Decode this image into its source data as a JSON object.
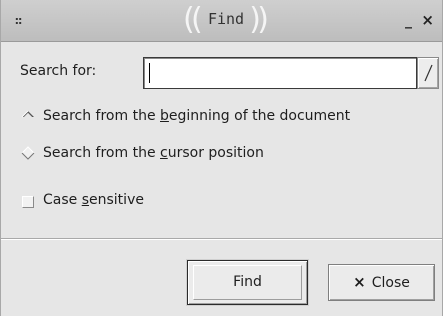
{
  "window": {
    "title": "Find",
    "menu_glyph": "::",
    "minimize_glyph": "_",
    "close_glyph": "×"
  },
  "search": {
    "label": "Search for:",
    "value": "",
    "placeholder": "",
    "dropdown_glyph": "/"
  },
  "options": {
    "from_beginning": {
      "label_before": "Search from the ",
      "label_mnemonic": "b",
      "label_after": "eginning of the document",
      "selected": true
    },
    "from_cursor": {
      "label_before": "Search from the ",
      "label_mnemonic": "c",
      "label_after": "ursor position",
      "selected": false
    },
    "case_sensitive": {
      "label_before": "Case ",
      "label_mnemonic": "s",
      "label_after": "ensitive",
      "checked": false
    }
  },
  "buttons": {
    "find_label": "Find",
    "close_label": "Close",
    "close_icon": "×"
  },
  "colors": {
    "window_bg": "#e6e6e6",
    "titlebar_bg": "#c6c6c6",
    "input_bg": "#ffffff"
  }
}
